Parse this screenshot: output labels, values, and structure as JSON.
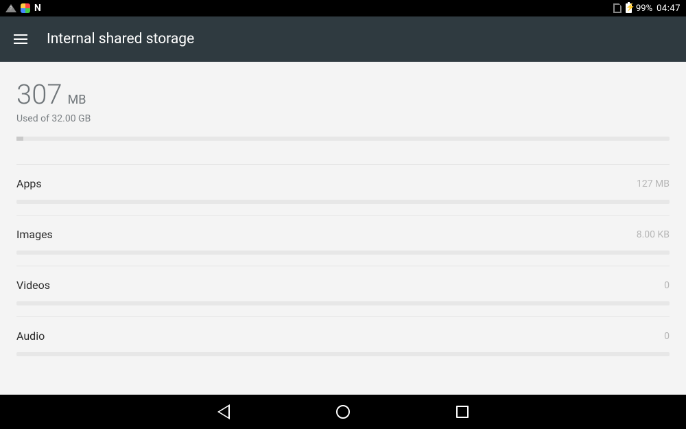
{
  "status": {
    "battery_pct": "99%",
    "time": "04:47"
  },
  "appbar": {
    "title": "Internal shared storage"
  },
  "summary": {
    "used_value": "307",
    "used_unit": "MB",
    "subtitle": "Used of 32.00 GB"
  },
  "categories": [
    {
      "label": "Apps",
      "size": "127 MB"
    },
    {
      "label": "Images",
      "size": "8.00 KB"
    },
    {
      "label": "Videos",
      "size": "0"
    },
    {
      "label": "Audio",
      "size": "0"
    }
  ]
}
